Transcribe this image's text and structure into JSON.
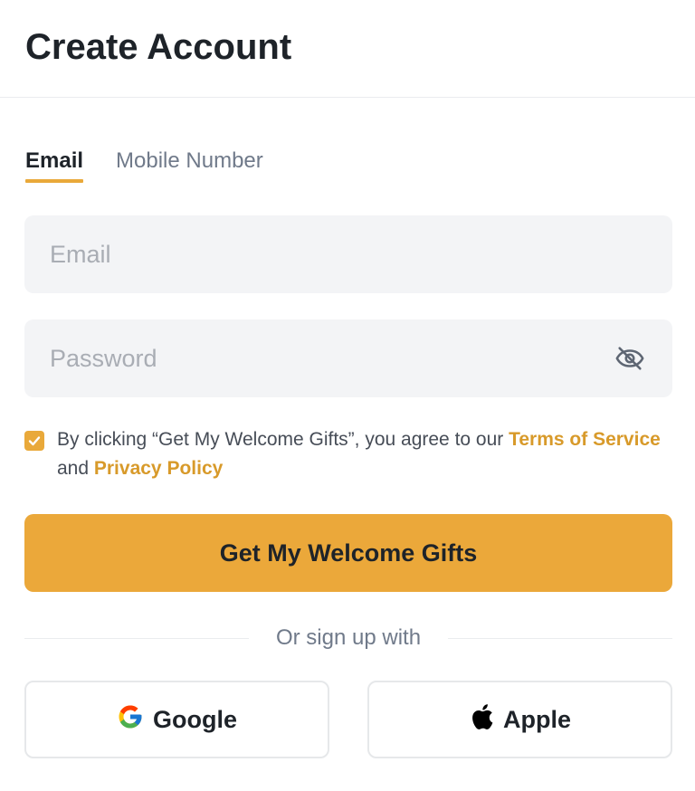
{
  "header": {
    "title": "Create Account"
  },
  "tabs": [
    {
      "label": "Email",
      "active": true
    },
    {
      "label": "Mobile Number",
      "active": false
    }
  ],
  "form": {
    "email": {
      "placeholder": "Email",
      "value": ""
    },
    "password": {
      "placeholder": "Password",
      "value": "",
      "toggle_icon": "eye-slash-icon"
    }
  },
  "consent": {
    "checked": true,
    "prefix": "By clicking “Get My Welcome Gifts”, you agree to our ",
    "terms_link": "Terms of Service",
    "middle": " and ",
    "privacy_link": "Privacy Policy"
  },
  "cta": {
    "label": "Get My Welcome Gifts"
  },
  "divider": {
    "label": "Or sign up with"
  },
  "social": {
    "google": {
      "label": "Google",
      "icon": "google-icon"
    },
    "apple": {
      "label": "Apple",
      "icon": "apple-icon"
    }
  },
  "colors": {
    "accent": "#e9a93a",
    "button": "#eba83a",
    "link": "#d89a2a",
    "field_bg": "#f3f4f6"
  }
}
